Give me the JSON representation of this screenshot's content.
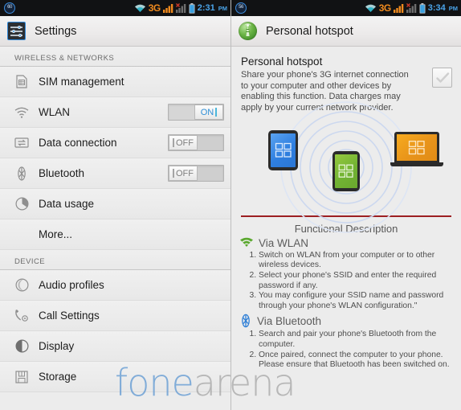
{
  "left": {
    "statusbar": {
      "badge": "60",
      "network_label": "3G",
      "time": "2:31",
      "meridiem": "PM",
      "icons": [
        "wifi-icon",
        "signal-bars-icon",
        "signal-bars-off-icon",
        "battery-icon"
      ]
    },
    "titlebar": {
      "title": "Settings",
      "icon": "settings-sliders-icon"
    },
    "sections": [
      {
        "header": "WIRELESS & NETWORKS",
        "rows": [
          {
            "label": "SIM management",
            "icon": "sim-card-icon",
            "toggle": null
          },
          {
            "label": "WLAN",
            "icon": "wifi-icon",
            "toggle": {
              "state": "ON",
              "on": true
            }
          },
          {
            "label": "Data connection",
            "icon": "data-transfer-icon",
            "toggle": {
              "state": "OFF",
              "on": false
            }
          },
          {
            "label": "Bluetooth",
            "icon": "bluetooth-icon",
            "toggle": {
              "state": "OFF",
              "on": false
            }
          },
          {
            "label": "Data usage",
            "icon": "pie-chart-icon",
            "toggle": null
          },
          {
            "label": "More...",
            "icon": null,
            "toggle": null
          }
        ]
      },
      {
        "header": "DEVICE",
        "rows": [
          {
            "label": "Audio profiles",
            "icon": "moon-volume-icon",
            "toggle": null
          },
          {
            "label": "Call Settings",
            "icon": "phone-gear-icon",
            "toggle": null
          },
          {
            "label": "Display",
            "icon": "brightness-contrast-icon",
            "toggle": null
          },
          {
            "label": "Storage",
            "icon": "floppy-disk-icon",
            "toggle": null
          }
        ]
      }
    ]
  },
  "right": {
    "statusbar": {
      "badge": "56",
      "network_label": "3G",
      "time": "3:34",
      "meridiem": "PM",
      "icons": [
        "wifi-icon",
        "signal-bars-icon",
        "signal-bars-off-icon",
        "battery-icon"
      ]
    },
    "titlebar": {
      "title": "Personal hotspot",
      "icon": "hotspot-tower-icon"
    },
    "heading": "Personal hotspot",
    "description": "Share your phone's 3G internet connection to your computer and other devices by enabling this function. Data charges may apply by your current network provider.",
    "checkbox": {
      "name": "enable-hotspot-checkbox",
      "checked": false
    },
    "illustration": {
      "tablet_color": "#2f7fe0",
      "phone_color": "#72b333",
      "laptop_color": "#e8941a",
      "ring_color": "#ccd8ef"
    },
    "functional_description_title": "Functional Description",
    "groups": [
      {
        "title": "Via WLAN",
        "icon": "wifi-icon",
        "icon_color": "#5aa82e",
        "steps": [
          "Switch on WLAN from your computer or to other wireless devices.",
          "Select your phone's SSID and enter the required password if any.",
          "You may configure your SSID name and password through your phone's WLAN configuration.\""
        ]
      },
      {
        "title": "Via Bluetooth",
        "icon": "bluetooth-icon",
        "icon_color": "#2f7fd6",
        "steps": [
          "Search and pair your phone's Bluetooth from the computer.",
          "Once paired, connect the computer to your phone. Please ensure that Bluetooth has been switched on."
        ]
      }
    ]
  },
  "watermark": {
    "part1": "fone",
    "part2": "arena"
  }
}
